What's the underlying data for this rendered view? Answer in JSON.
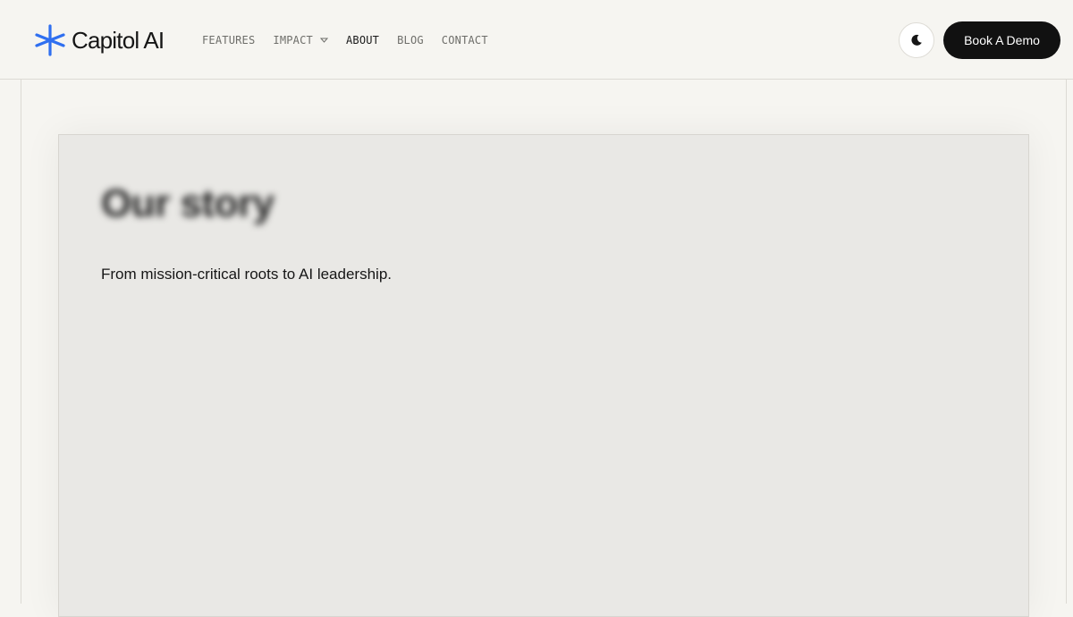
{
  "brand": {
    "name": "Capitol AI",
    "accent_color": "#2f6ff0"
  },
  "nav": {
    "items": [
      {
        "label": "FEATURES",
        "active": false,
        "has_dropdown": false
      },
      {
        "label": "IMPACT",
        "active": false,
        "has_dropdown": true
      },
      {
        "label": "ABOUT",
        "active": true,
        "has_dropdown": false
      },
      {
        "label": "BLOG",
        "active": false,
        "has_dropdown": false
      },
      {
        "label": "CONTACT",
        "active": false,
        "has_dropdown": false
      }
    ]
  },
  "header_actions": {
    "theme_toggle_icon": "moon-icon",
    "demo_label": "Book A Demo"
  },
  "story": {
    "title": "Our story",
    "subtitle": "From mission-critical roots to AI leadership."
  }
}
